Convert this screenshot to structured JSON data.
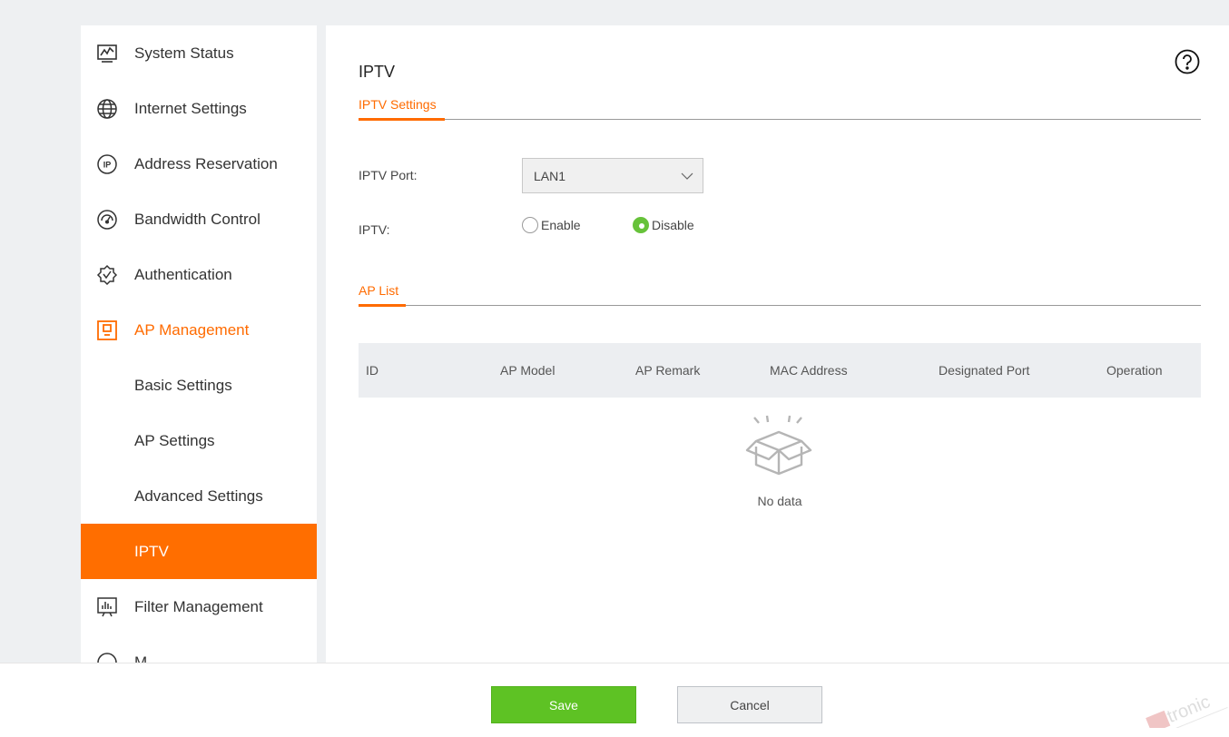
{
  "sidebar": {
    "items": [
      {
        "label": "System Status",
        "icon": "monitor-chart-icon"
      },
      {
        "label": "Internet Settings",
        "icon": "globe-icon"
      },
      {
        "label": "Address Reservation",
        "icon": "ip-icon"
      },
      {
        "label": "Bandwidth Control",
        "icon": "gauge-icon"
      },
      {
        "label": "Authentication",
        "icon": "shield-check-icon"
      },
      {
        "label": "AP Management",
        "icon": "ap-device-icon"
      },
      {
        "label": "Basic Settings"
      },
      {
        "label": "AP Settings"
      },
      {
        "label": "Advanced Settings"
      },
      {
        "label": "IPTV"
      },
      {
        "label": "Filter Management",
        "icon": "bar-chart-board-icon"
      },
      {
        "label": "M...",
        "icon": "circle-icon"
      }
    ],
    "active_item": "IPTV"
  },
  "main": {
    "title": "IPTV",
    "help_icon": "question-circle-icon",
    "iptv_tab": "IPTV Settings",
    "form": {
      "port_label": "IPTV Port:",
      "port_value": "LAN1",
      "iptv_label": "IPTV:",
      "enable_label": "Enable",
      "disable_label": "Disable",
      "selected": "Disable"
    },
    "ap_tab": "AP List",
    "table": {
      "columns": [
        "ID",
        "AP Model",
        "AP Remark",
        "MAC Address",
        "Designated Port",
        "Operation"
      ],
      "empty_text": "No data"
    }
  },
  "footer": {
    "save_label": "Save",
    "cancel_label": "Cancel"
  },
  "watermark": {
    "text": "tronic"
  },
  "colors": {
    "accent": "#ff6e00",
    "save": "#5ec224",
    "radio_selected": "#67c23a"
  }
}
